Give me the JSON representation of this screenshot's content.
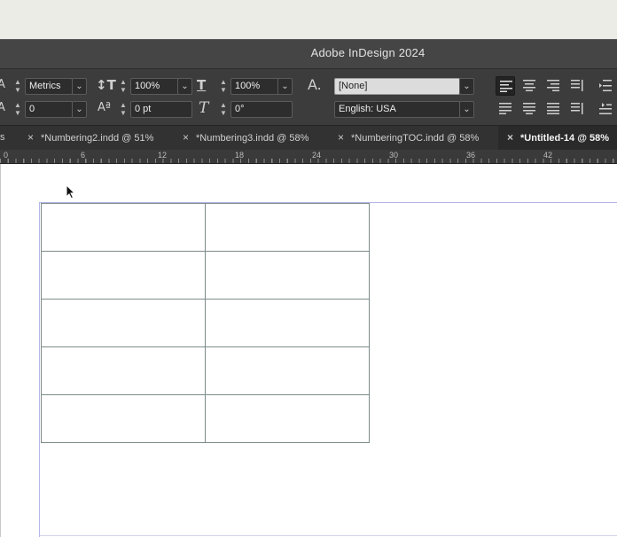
{
  "app": {
    "title": "Adobe InDesign 2024"
  },
  "control_panel": {
    "kerning": {
      "value": "Metrics"
    },
    "tracking": {
      "value": "0"
    },
    "vertical_scale": {
      "value": "100%"
    },
    "baseline_shift": {
      "value": "0 pt"
    },
    "horizontal_scale": {
      "value": "100%"
    },
    "skew": {
      "value": "0°"
    },
    "char_style": {
      "value": "[None]"
    },
    "language": {
      "value": "English: USA"
    }
  },
  "tabs": [
    {
      "label": "s",
      "closable": false,
      "active": false
    },
    {
      "label": "*Numbering2.indd @ 51%",
      "closable": true,
      "active": false
    },
    {
      "label": "*Numbering3.indd @ 58%",
      "closable": true,
      "active": false
    },
    {
      "label": "*NumberingTOC.indd @ 58%",
      "closable": true,
      "active": false
    },
    {
      "label": "*Untitled-14 @ 58%",
      "closable": true,
      "active": true
    }
  ],
  "ruler": {
    "labels": [
      "0",
      "6",
      "12",
      "18",
      "24",
      "30",
      "36",
      "42"
    ]
  },
  "document": {
    "table": {
      "rows": 5,
      "columns": 2
    }
  },
  "colors": {
    "margin_guide": "#b5b5ea",
    "table_stroke": "#7d8a8a",
    "panel_bg": "#3c3c3c"
  }
}
